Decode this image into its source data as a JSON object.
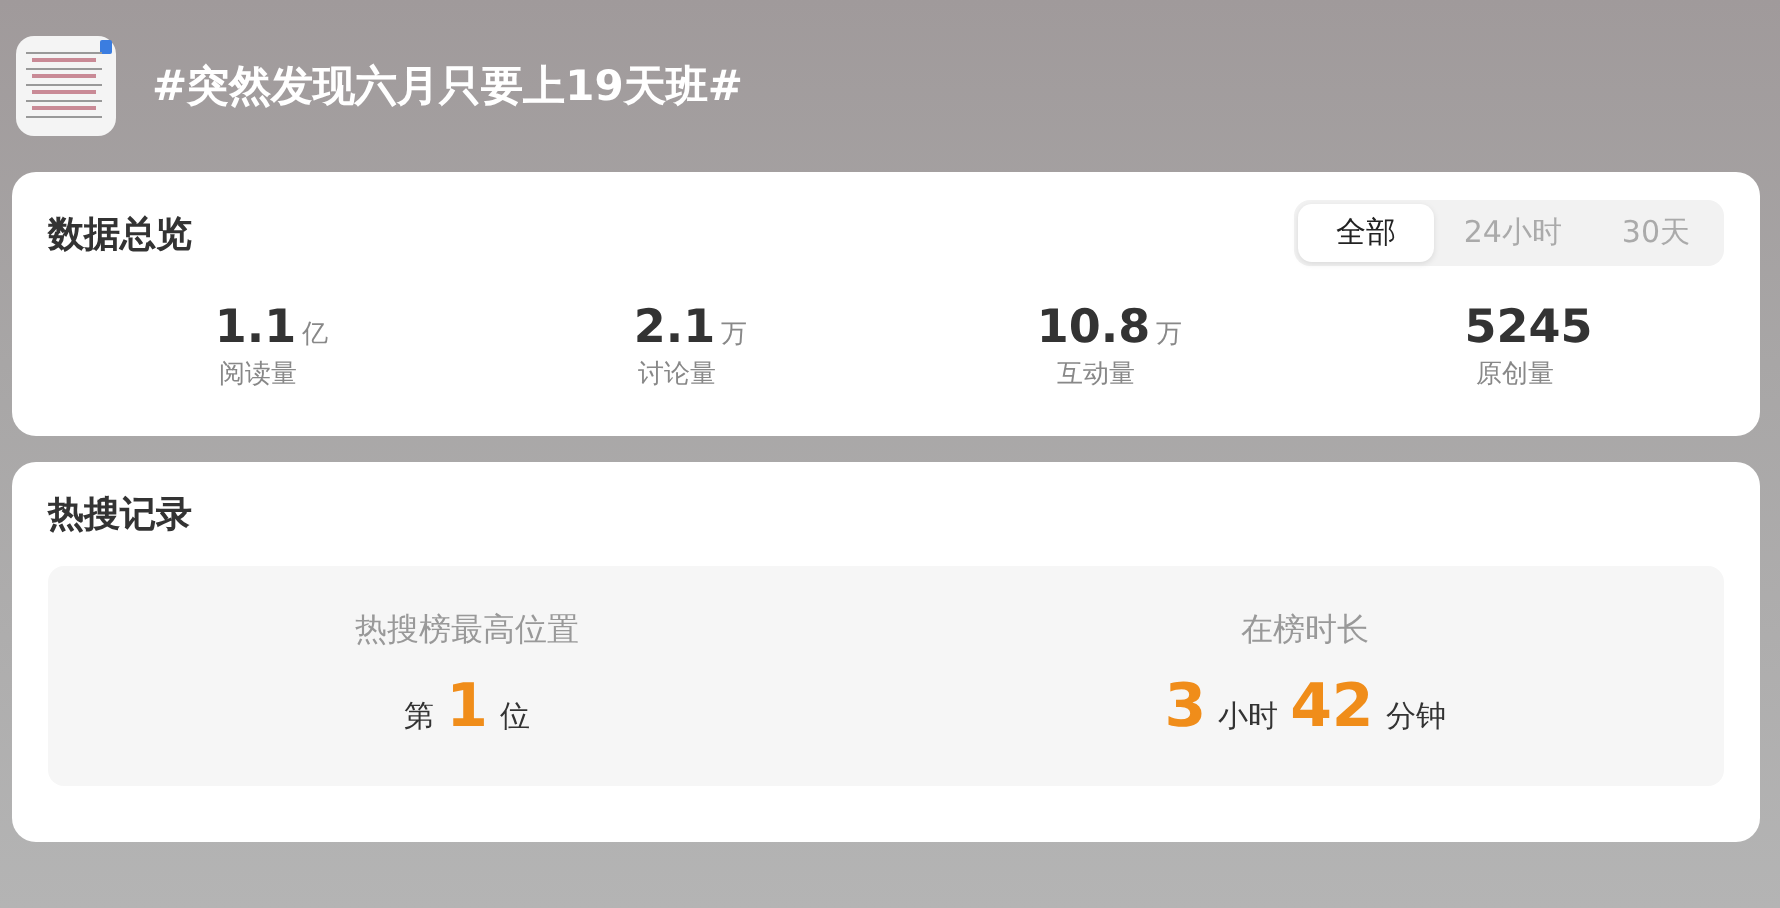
{
  "topic": {
    "title": "#突然发现六月只要上19天班#"
  },
  "overview": {
    "title": "数据总览",
    "tabs": [
      {
        "label": "全部",
        "selected": true
      },
      {
        "label": "24小时",
        "selected": false
      },
      {
        "label": "30天",
        "selected": false
      }
    ],
    "stats": [
      {
        "value": "1.1",
        "unit": "亿",
        "label": "阅读量"
      },
      {
        "value": "2.1",
        "unit": "万",
        "label": "讨论量"
      },
      {
        "value": "10.8",
        "unit": "万",
        "label": "互动量"
      },
      {
        "value": "5245",
        "label": "原创量"
      }
    ]
  },
  "records": {
    "title": "热搜记录",
    "items": [
      {
        "label": "热搜榜最高位置",
        "parts": [
          {
            "kind": "unit",
            "text": "第"
          },
          {
            "kind": "number",
            "text": "1"
          },
          {
            "kind": "unit",
            "text": "位"
          }
        ]
      },
      {
        "label": "在榜时长",
        "parts": [
          {
            "kind": "number",
            "text": "3"
          },
          {
            "kind": "unit",
            "text": "小时"
          },
          {
            "kind": "number",
            "text": "42"
          },
          {
            "kind": "unit",
            "text": "分钟"
          }
        ]
      }
    ]
  }
}
